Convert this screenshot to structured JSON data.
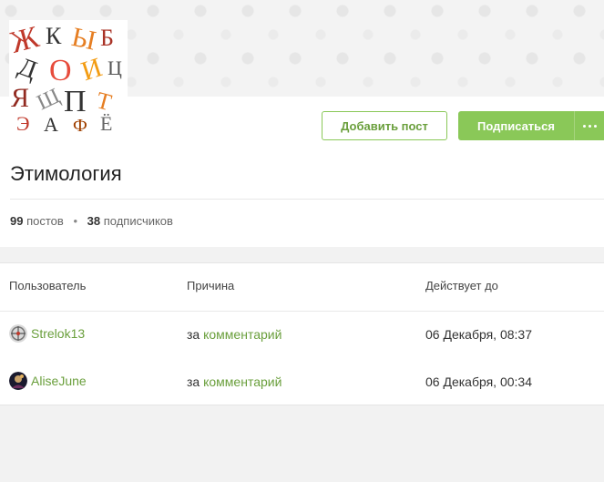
{
  "community": {
    "name": "Этимология",
    "posts_count": "99",
    "posts_label": "постов",
    "subscribers_count": "38",
    "subscribers_label": "подписчиков"
  },
  "actions": {
    "add_post_label": "Добавить пост",
    "subscribe_label": "Подписаться",
    "more_icon": "ellipsis-icon"
  },
  "colors": {
    "accent": "#8ac858",
    "link": "#6a9f3c"
  },
  "bans_table": {
    "headers": [
      "Пользователь",
      "Причина",
      "Действует до"
    ],
    "rows": [
      {
        "user": "Strelok13",
        "reason_prefix": "за",
        "reason_link": "комментарий",
        "until": "06 Декабря, 08:37"
      },
      {
        "user": "AliseJune",
        "reason_prefix": "за",
        "reason_link": "комментарий",
        "until": "06 Декабря, 00:34"
      }
    ]
  }
}
